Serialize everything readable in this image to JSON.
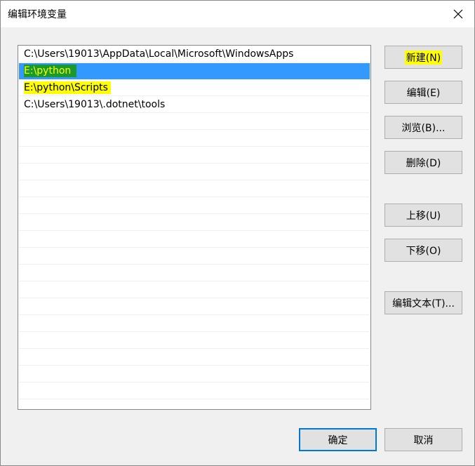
{
  "window": {
    "title": "编辑环境变量",
    "close_icon": "close-icon"
  },
  "list": {
    "items": [
      {
        "text": "C:\\Users\\19013\\AppData\\Local\\Microsoft\\WindowsApps",
        "selected": false,
        "highlight": false
      },
      {
        "text": "E:\\python",
        "selected": true,
        "highlight": true
      },
      {
        "text": "E:\\python\\Scripts",
        "selected": false,
        "highlight": true
      },
      {
        "text": "C:\\Users\\19013\\.dotnet\\tools",
        "selected": false,
        "highlight": false
      }
    ]
  },
  "buttons": {
    "new": "新建(N)",
    "edit": "编辑(E)",
    "browse": "浏览(B)...",
    "delete": "删除(D)",
    "move_up": "上移(U)",
    "move_down": "下移(O)",
    "edit_text": "编辑文本(T)...",
    "ok": "确定",
    "cancel": "取消"
  },
  "colors": {
    "selection": "#3399ff",
    "highlight_yellow": "#ffff00",
    "highlight_green": "#1a9a2e",
    "accent_border": "#0078d7"
  }
}
